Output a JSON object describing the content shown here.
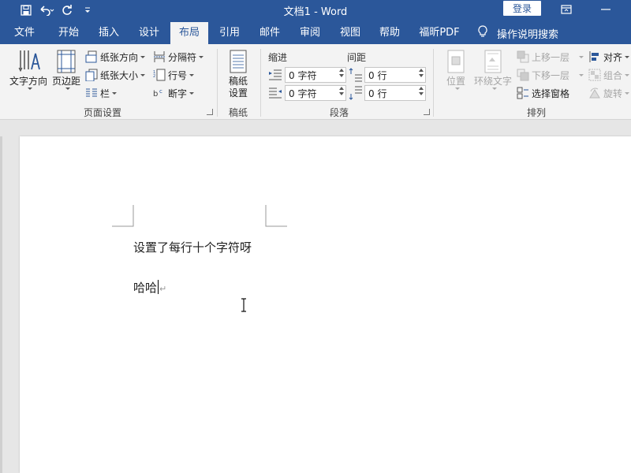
{
  "title_bar": {
    "title": "文档1  -  Word",
    "login_label": "登录"
  },
  "tabs": [
    {
      "label": "文件"
    },
    {
      "label": "开始"
    },
    {
      "label": "插入"
    },
    {
      "label": "设计"
    },
    {
      "label": "布局"
    },
    {
      "label": "引用"
    },
    {
      "label": "邮件"
    },
    {
      "label": "审阅"
    },
    {
      "label": "视图"
    },
    {
      "label": "帮助"
    },
    {
      "label": "福昕PDF"
    }
  ],
  "tell_me": "操作说明搜索",
  "ribbon": {
    "page_setup": {
      "group_label": "页面设置",
      "text_direction": "文字方向",
      "margins": "页边距",
      "orientation": "纸张方向",
      "size": "纸张大小",
      "columns": "栏",
      "breaks": "分隔符",
      "line_numbers": "行号",
      "hyphenation": "断字"
    },
    "manuscript": {
      "group_label": "稿纸",
      "button": "稿纸\n设置",
      "button_line1": "稿纸",
      "button_line2": "设置"
    },
    "paragraph": {
      "group_label": "段落",
      "indent_header": "缩进",
      "spacing_header": "间距",
      "indent_left": "0 字符",
      "indent_right": "0 字符",
      "spacing_before": "0 行",
      "spacing_after": "0 行"
    },
    "arrange": {
      "group_label": "排列",
      "position": "位置",
      "wrap_text": "环绕文字",
      "bring_forward": "上移一层",
      "send_backward": "下移一层",
      "selection_pane": "选择窗格",
      "align": "对齐",
      "group": "组合",
      "rotate": "旋转"
    }
  },
  "document": {
    "line1": "设置了每行十个字符呀",
    "line2": "哈哈"
  },
  "colors": {
    "brand": "#2b579a",
    "ribbon_bg": "#f3f3f3",
    "doc_bg": "#e6e6e6"
  }
}
